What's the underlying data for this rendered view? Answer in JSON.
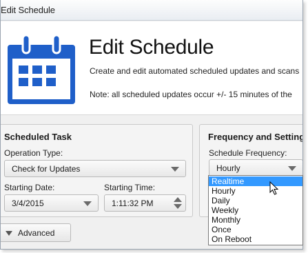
{
  "window": {
    "title": "Edit Schedule"
  },
  "header": {
    "title": "Edit Schedule",
    "description": "Create and edit automated scheduled updates and scans",
    "note": "Note: all scheduled updates occur +/- 15 minutes of the"
  },
  "scheduled_task": {
    "title": "Scheduled Task",
    "operation_type_label": "Operation Type:",
    "operation_type_value": "Check for Updates",
    "starting_date_label": "Starting Date:",
    "starting_date_value": "3/4/2015",
    "starting_time_label": "Starting Time:",
    "starting_time_value": "1:11:32 PM"
  },
  "frequency": {
    "title": "Frequency and Settings",
    "schedule_frequency_label": "Schedule Frequency:",
    "selected_value": "Hourly",
    "options": [
      "Realtime",
      "Hourly",
      "Daily",
      "Weekly",
      "Monthly",
      "Once",
      "On Reboot"
    ],
    "highlighted_option": "Realtime"
  },
  "footer": {
    "advanced_label": "Advanced"
  },
  "colors": {
    "accent": "#1f5fc9",
    "selection": "#3399ff"
  },
  "icons": [
    "calendar-icon",
    "chevron-down-icon",
    "spinner-icon",
    "mouse-cursor-icon"
  ]
}
